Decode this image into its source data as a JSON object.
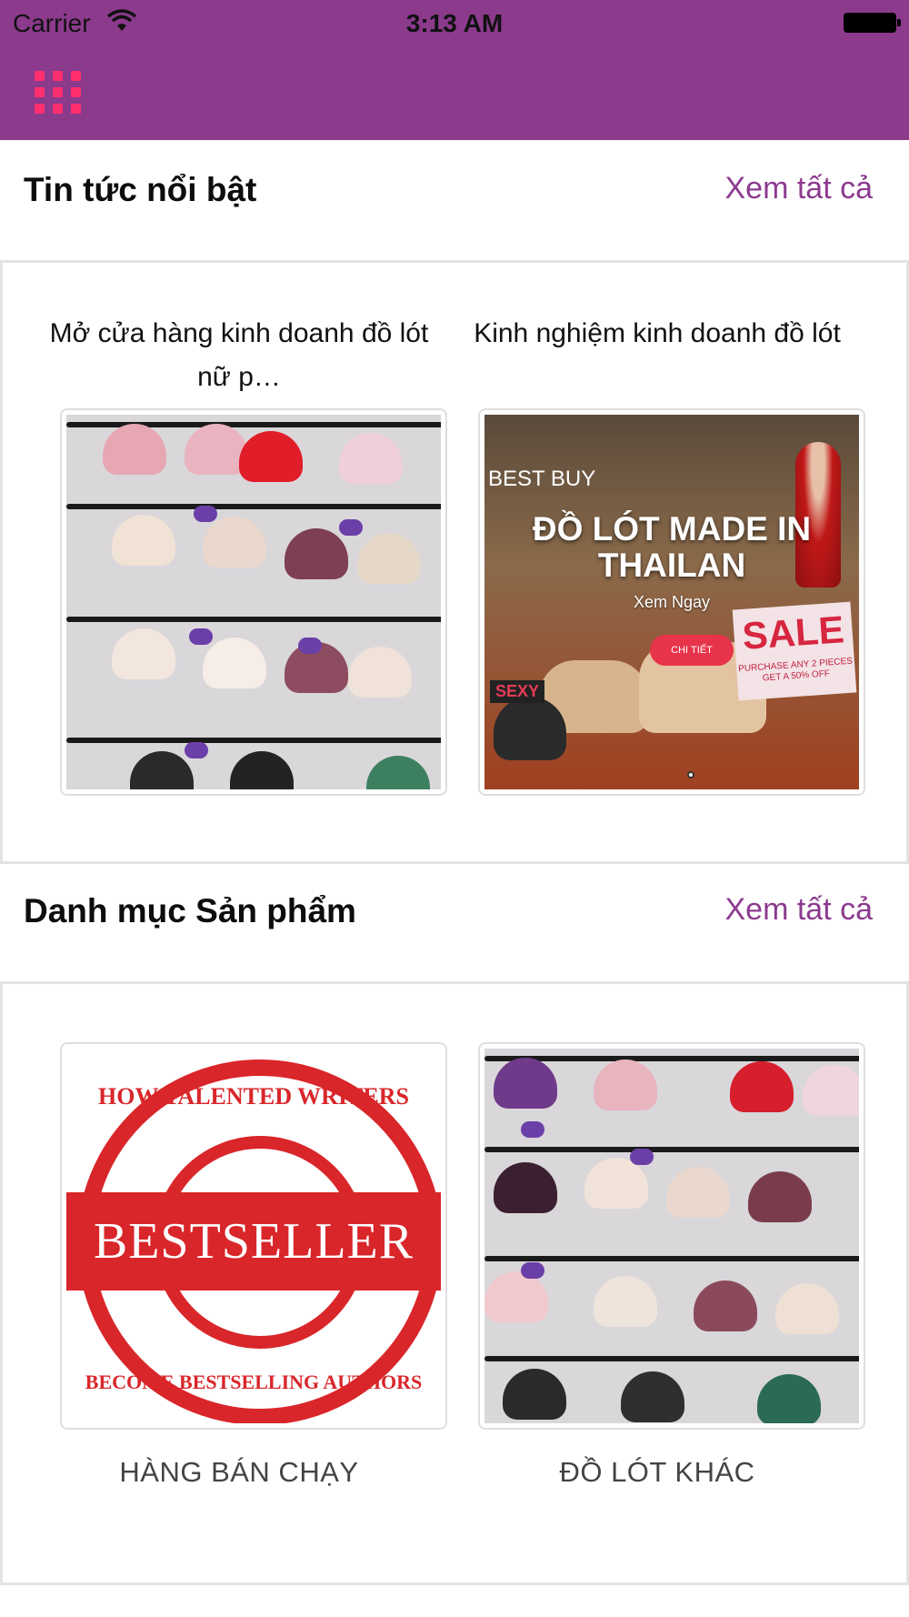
{
  "status_bar": {
    "carrier": "Carrier",
    "time": "3:13 AM"
  },
  "header": {
    "menu_icon": "grid-menu-icon",
    "background_color": "#8b3a8c",
    "menu_color": "#ff2f6e"
  },
  "featured_news": {
    "title": "Tin tức nổi bật",
    "see_all": "Xem tất cả",
    "items": [
      {
        "title": "Mở cửa hàng kinh doanh đồ lót nữ p…",
        "image": "bra-display-wall"
      },
      {
        "title": "Kinh nghiệm kinh doanh đồ lót",
        "image": "promo-banner",
        "banner": {
          "headline": "ĐỒ LÓT MADE IN THAILAN",
          "subtitle": "Xem Ngay",
          "button": "CHI TIẾT",
          "best_buy": "BEST BUY",
          "sale": "SALE",
          "sale_small": "PURCHASE ANY 2 PIECES GET A 50% OFF",
          "sexy": "SEXY"
        }
      }
    ]
  },
  "product_categories": {
    "title": "Danh mục Sản phẩm",
    "see_all": "Xem tất cả",
    "items": [
      {
        "label": "HÀNG BÁN CHẠY",
        "image": "bestseller-stamp",
        "stamp": {
          "main": "BESTSELLER",
          "top": "HOW TALENTED WRITERS",
          "bottom": "BECOME BESTSELLING AUTHORS"
        }
      },
      {
        "label": "ĐỒ LÓT KHÁC",
        "image": "bra-display-wall"
      }
    ]
  },
  "colors": {
    "accent": "#8c3b8f",
    "divider": "#e3e3e3"
  }
}
